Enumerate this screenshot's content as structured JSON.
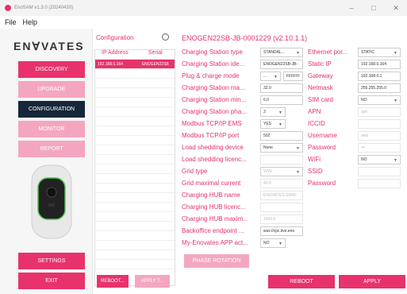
{
  "window": {
    "title": "EnoSAM v1.3.0 (20240430)",
    "controls": {
      "minimize": "–",
      "maximize": "□",
      "close": "✕"
    }
  },
  "menu": [
    "File",
    "Help"
  ],
  "sidebar": {
    "logo": "ENⱯVATES",
    "nav": {
      "discovery": "DISCOVERY",
      "upgrade": "UPGRADE",
      "configuration": "CONFIGURATION",
      "monitor": "MONITOR",
      "report": "REPORT",
      "settings": "SETTINGS",
      "exit": "EXIT"
    }
  },
  "config": {
    "header": "Configuration",
    "columns": {
      "ip": "IP Address",
      "serial": "Serial"
    },
    "rows": [
      {
        "ip": "192.168.0.164",
        "serial": "ENOGEN22SB"
      }
    ],
    "buttons": {
      "reboot": "REBOOT...",
      "apply": "APPLY T..."
    }
  },
  "detail": {
    "title": "ENOGEN22SB-JB-0001229 (v2.10.1.1)",
    "left_labels": [
      "Charging Station type",
      "Charging Station ide...",
      "Plug & charge mode",
      "Charging Station ma...",
      "Charging Station min...",
      "Charging Station pha...",
      "Modbus TCP/IP EMS",
      "Modbus TCP/IP port",
      "Load shedding device",
      "Load shedding licenc...",
      "Grid type",
      "Grid maximal current",
      "Charging HUB name",
      "Charging HUB licenc...",
      "Charging HUB maxim...",
      "Backoffice endpoint ...",
      "My-Enovates APP act..."
    ],
    "left_values": {
      "station_type": "STANDAL...",
      "station_id": "ENOGEN22SB-JB-",
      "plug_mode": "...",
      "plug_extra": "FFFFFI",
      "station_max": "32.0",
      "station_min": "6.0",
      "station_phase": "3",
      "modbus_ems": "YES",
      "modbus_port": "502",
      "load_shedding_device": "None",
      "load_shedding_licence": "",
      "grid_type": "WYE",
      "grid_max": "40.0",
      "hub_name": "ENOVATES-SMAF",
      "hub_licence": "",
      "hub_max": "1000.0",
      "backoffice": "wss://cpc.live.eno",
      "app_active": "NO"
    },
    "right_labels": [
      "Ethernet por...",
      "Static IP",
      "Gateway",
      "Netmask",
      "SIM card",
      "APN",
      "ICCID",
      "Username",
      "Password",
      "WiFi",
      "SSID",
      "Password"
    ],
    "right_values": {
      "ethernet": "STATIC",
      "static_ip": "192.168.0.164",
      "gateway": "192.168.0.1",
      "netmask": "255.255.255.0",
      "sim": "NO",
      "apn": "apn",
      "iccid": "",
      "username": "web",
      "password": "•••",
      "wifi": "NO",
      "ssid": "",
      "wifi_password": ""
    },
    "buttons": {
      "phase_rotation": "PHASE ROTATION",
      "reboot": "REBOOT",
      "apply": "APPLY"
    }
  },
  "colors": {
    "accent": "#e8326b",
    "accent_disabled": "#f4a6c0",
    "nav_dark": "#16273a"
  }
}
